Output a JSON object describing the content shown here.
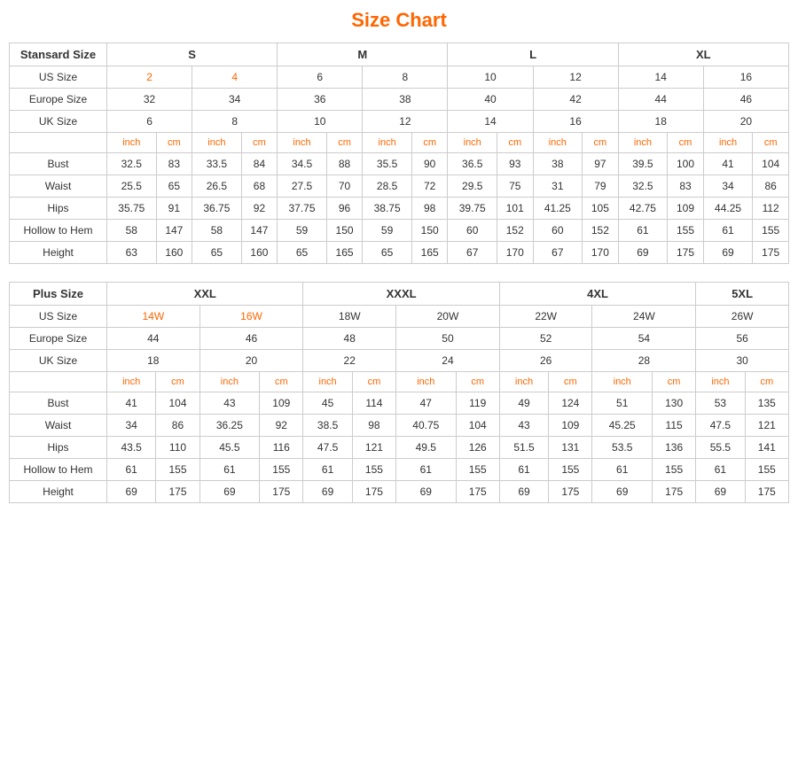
{
  "title": "Size Chart",
  "standard": {
    "section_label": "Stansard Size",
    "size_groups": [
      "S",
      "M",
      "L",
      "XL"
    ],
    "us_sizes": [
      "2",
      "4",
      "6",
      "8",
      "10",
      "12",
      "14",
      "16"
    ],
    "europe_sizes": [
      "32",
      "34",
      "36",
      "38",
      "40",
      "42",
      "44",
      "46"
    ],
    "uk_sizes": [
      "6",
      "8",
      "10",
      "12",
      "14",
      "16",
      "18",
      "20"
    ],
    "sub_headers": [
      "inch",
      "cm",
      "inch",
      "cm",
      "inch",
      "cm",
      "inch",
      "cm",
      "inch",
      "cm",
      "inch",
      "cm",
      "inch",
      "cm",
      "inch",
      "cm"
    ],
    "rows": [
      {
        "label": "Bust",
        "values": [
          "32.5",
          "83",
          "33.5",
          "84",
          "34.5",
          "88",
          "35.5",
          "90",
          "36.5",
          "93",
          "38",
          "97",
          "39.5",
          "100",
          "41",
          "104"
        ]
      },
      {
        "label": "Waist",
        "values": [
          "25.5",
          "65",
          "26.5",
          "68",
          "27.5",
          "70",
          "28.5",
          "72",
          "29.5",
          "75",
          "31",
          "79",
          "32.5",
          "83",
          "34",
          "86"
        ]
      },
      {
        "label": "Hips",
        "values": [
          "35.75",
          "91",
          "36.75",
          "92",
          "37.75",
          "96",
          "38.75",
          "98",
          "39.75",
          "101",
          "41.25",
          "105",
          "42.75",
          "109",
          "44.25",
          "112"
        ]
      },
      {
        "label": "Hollow to Hem",
        "values": [
          "58",
          "147",
          "58",
          "147",
          "59",
          "150",
          "59",
          "150",
          "60",
          "152",
          "60",
          "152",
          "61",
          "155",
          "61",
          "155"
        ]
      },
      {
        "label": "Height",
        "values": [
          "63",
          "160",
          "65",
          "160",
          "65",
          "165",
          "65",
          "165",
          "67",
          "170",
          "67",
          "170",
          "69",
          "175",
          "69",
          "175"
        ]
      }
    ]
  },
  "plus": {
    "section_label": "Plus Size",
    "size_groups": [
      "XXL",
      "XXXL",
      "4XL",
      "5XL"
    ],
    "us_sizes": [
      "14W",
      "16W",
      "18W",
      "20W",
      "22W",
      "24W",
      "26W"
    ],
    "europe_sizes": [
      "44",
      "46",
      "48",
      "50",
      "52",
      "54",
      "56"
    ],
    "uk_sizes": [
      "18",
      "20",
      "22",
      "24",
      "26",
      "28",
      "30"
    ],
    "sub_headers": [
      "inch",
      "cm",
      "inch",
      "cm",
      "inch",
      "cm",
      "inch",
      "cm",
      "inch",
      "cm",
      "inch",
      "cm",
      "inch",
      "cm"
    ],
    "rows": [
      {
        "label": "Bust",
        "values": [
          "41",
          "104",
          "43",
          "109",
          "45",
          "114",
          "47",
          "119",
          "49",
          "124",
          "51",
          "130",
          "53",
          "135"
        ]
      },
      {
        "label": "Waist",
        "values": [
          "34",
          "86",
          "36.25",
          "92",
          "38.5",
          "98",
          "40.75",
          "104",
          "43",
          "109",
          "45.25",
          "115",
          "47.5",
          "121"
        ]
      },
      {
        "label": "Hips",
        "values": [
          "43.5",
          "110",
          "45.5",
          "116",
          "47.5",
          "121",
          "49.5",
          "126",
          "51.5",
          "131",
          "53.5",
          "136",
          "55.5",
          "141"
        ]
      },
      {
        "label": "Hollow to Hem",
        "values": [
          "61",
          "155",
          "61",
          "155",
          "61",
          "155",
          "61",
          "155",
          "61",
          "155",
          "61",
          "155",
          "61",
          "155"
        ]
      },
      {
        "label": "Height",
        "values": [
          "69",
          "175",
          "69",
          "175",
          "69",
          "175",
          "69",
          "175",
          "69",
          "175",
          "69",
          "175",
          "69",
          "175"
        ]
      }
    ]
  }
}
